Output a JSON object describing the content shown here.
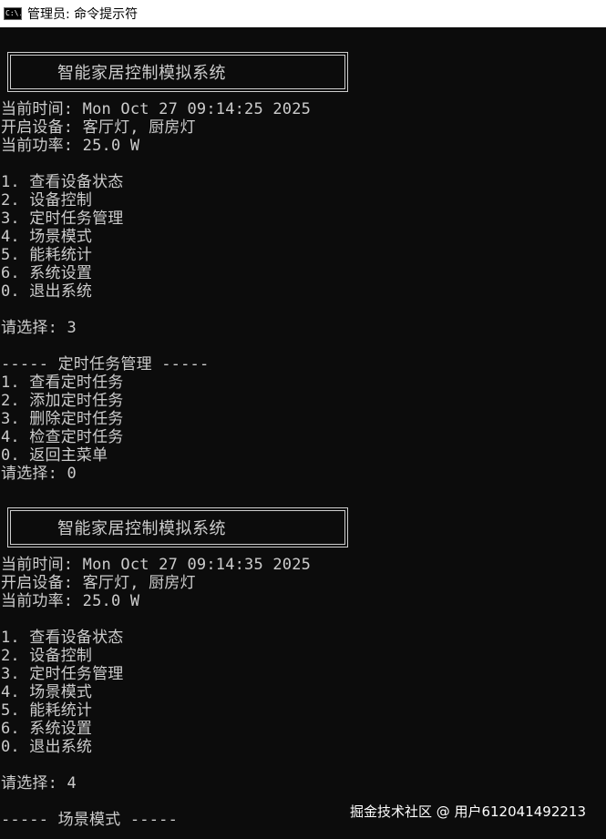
{
  "window": {
    "icon_text": "C:\\.",
    "title": "管理员: 命令提示符"
  },
  "blocks": [
    {
      "banner": "智能家居控制模拟系统",
      "time": "当前时间: Mon Oct 27 09:14:25 2025",
      "devices": "开启设备: 客厅灯, 厨房灯",
      "power": "当前功率: 25.0 W",
      "menu": [
        "1. 查看设备状态",
        "2. 设备控制",
        "3. 定时任务管理",
        "4. 场景模式",
        "5. 能耗统计",
        "6. 系统设置",
        "0. 退出系统"
      ],
      "prompt": "请选择: 3"
    },
    {
      "banner": "智能家居控制模拟系统",
      "time": "当前时间: Mon Oct 27 09:14:35 2025",
      "devices": "开启设备: 客厅灯, 厨房灯",
      "power": "当前功率: 25.0 W",
      "menu": [
        "1. 查看设备状态",
        "2. 设备控制",
        "3. 定时任务管理",
        "4. 场景模式",
        "5. 能耗统计",
        "6. 系统设置",
        "0. 退出系统"
      ],
      "prompt": "请选择: 4"
    }
  ],
  "submenu": {
    "header": "----- 定时任务管理 -----",
    "items": [
      "1. 查看定时任务",
      "2. 添加定时任务",
      "3. 删除定时任务",
      "4. 检查定时任务",
      "0. 返回主菜单"
    ],
    "prompt": "请选择: 0"
  },
  "scene_header": "----- 场景模式 -----",
  "watermark": "掘金技术社区 @ 用户612041492213"
}
